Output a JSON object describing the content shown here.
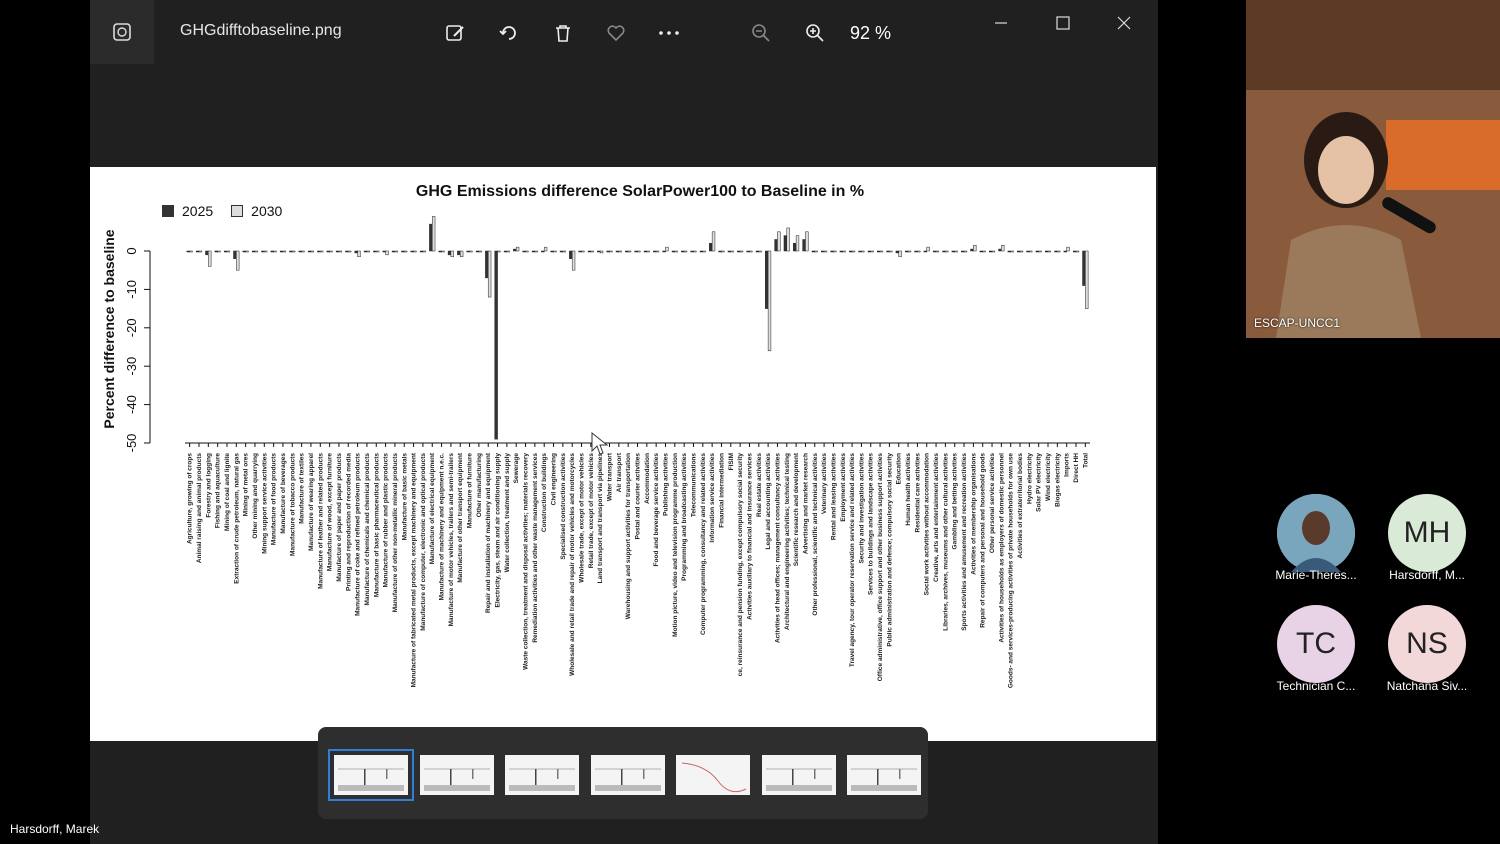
{
  "viewer": {
    "filename": "GHGdifftobaseline.png",
    "zoom": "92 %",
    "toolbar_icons": [
      "edit-image-icon",
      "rotate-icon",
      "delete-icon",
      "favorite-icon",
      "more-icon",
      "zoom-out-icon",
      "zoom-in-icon"
    ],
    "window_icons": [
      "minimize-icon",
      "maximize-icon",
      "close-icon"
    ]
  },
  "chart_data": {
    "type": "bar",
    "title": "GHG Emissions difference SolarPower100 to Baseline in %",
    "ylabel": "Percent difference to baseline",
    "ylim": [
      -50,
      0
    ],
    "yticks": [
      "0",
      "-10",
      "-20",
      "-30",
      "-40",
      "-50"
    ],
    "series": [
      {
        "name": "2025",
        "color": "#333333"
      },
      {
        "name": "2030",
        "color": "#dddddd"
      }
    ],
    "categories": [
      "Agriculture, growing of crops",
      "Animal raising and animal products",
      "Forestry and logging",
      "Fishing and aquaculture",
      "Mining of coal and lignite",
      "Extraction of crude petroleum, natural gas",
      "Mining of metal ores",
      "Other mining and quarrying",
      "Mining support service activities",
      "Manufacture of food products",
      "Manufacture of beverages",
      "Manufacture of tobacco products",
      "Manufacture of textiles",
      "Manufacture of wearing apparel",
      "Manufacture of leather and related products",
      "Manufacture of wood, except furniture",
      "Manufacture of paper and paper products",
      "Printing and reproduction of recorded media",
      "Manufacture of coke and refined petroleum products",
      "Manufacture of chemicals and chemical products",
      "Manufacture of basic pharmaceutical products",
      "Manufacture of rubber and plastic products",
      "Manufacture of other non-metallic mineral products",
      "Manufacture of basic metals",
      "Manufacture of fabricated metal products, except machinery and equipment",
      "Manufacture of computer, electronic and optical products",
      "Manufacture of electrical equipment",
      "Manufacture of machinery and equipment n.e.c.",
      "Manufacture of motor vehicles, trailers and semi-trailers",
      "Manufacture of other transport equipment",
      "Manufacture of furniture",
      "Other manufacturing",
      "Repair and installation of machinery and equipment",
      "Electricity, gas, steam and air conditioning supply",
      "Water collection, treatment and supply",
      "Sewerage",
      "Waste collection, treatment and disposal activities; materials recovery",
      "Remediation activities and other waste management services",
      "Construction of buildings",
      "Civil engineering",
      "Specialised construction activities",
      "Wholesale and retail trade and repair of motor vehicles and motorcycles",
      "Wholesale trade, except of motor vehicles",
      "Retail trade, except of motor vehicles",
      "Land transport and transport via pipelines",
      "Water transport",
      "Air transport",
      "Warehousing and support activities for transportation",
      "Postal and courier activities",
      "Accommodation",
      "Food and beverage service activities",
      "Publishing activities",
      "Motion picture, video and television programme production",
      "Programming and broadcasting activities",
      "Telecommunications",
      "Computer programming, consultancy and related activities",
      "Information service activities",
      "Financial intermediation",
      "FISIM",
      "ce, reinsurance and pension funding, except compulsory social security",
      "Activities auxiliary to financial and insurance services",
      "Real estate activities",
      "Legal and accounting activities",
      "Activities of head offices; management consultancy activities",
      "Architectural and engineering activities; technical testing",
      "Scientific research and development",
      "Advertising and market research",
      "Other professional, scientific and technical activities",
      "Veterinary activities",
      "Rental and leasing activities",
      "Employment activities",
      "Travel agency, tour operator reservation service and related activities",
      "Security and investigation activities",
      "Services to buildings and landscape activities",
      "Office administrative, office support and other business support activities",
      "Public administration and defence; compulsory social security",
      "Education",
      "Human health activities",
      "Residential care activities",
      "Social work activities without accommodation",
      "Creative, arts and entertainment activities",
      "Libraries, archives, museums and other cultural activities",
      "Gambling and betting activities",
      "Sports activities and amusement and recreation activities",
      "Activities of membership organisations",
      "Repair of computers and personal and household goods",
      "Other personal service activities",
      "Activities of households as employers of domestic personnel",
      "Goods- and services-producing activities of private households for own use",
      "Activities of extraterritorial bodies",
      "Hydro electricity",
      "Solar PV electricity",
      "Wind electricity",
      "Biogas electricity",
      "Imports",
      "Direct HH",
      "Total"
    ],
    "values_2025": [
      0,
      0,
      -1,
      0,
      0,
      -2,
      0,
      0,
      0,
      0,
      0,
      0,
      0,
      0,
      0,
      0,
      0,
      0,
      -0.5,
      0,
      0,
      0,
      0,
      0,
      0,
      0,
      7,
      0,
      -1,
      -1,
      0,
      0,
      -7,
      -49,
      0,
      0.5,
      0,
      0,
      0,
      0,
      0,
      -2,
      0,
      0,
      0,
      0,
      0,
      0,
      0,
      0,
      0,
      0,
      0,
      0,
      0,
      0,
      2,
      0,
      0,
      0,
      0,
      0,
      -15,
      3,
      4,
      2,
      3,
      0,
      0,
      0,
      0,
      0,
      0,
      0,
      0,
      0,
      -0.5,
      0,
      0,
      0,
      0,
      0,
      0,
      0,
      0.5,
      0,
      0,
      0.5,
      0,
      0,
      0,
      0,
      0,
      0,
      0,
      0,
      -9
    ],
    "values_2030": [
      0,
      0,
      -4,
      0,
      0,
      -5,
      0,
      0,
      0,
      0,
      0,
      0,
      0,
      0,
      0,
      0,
      0,
      0,
      -1.5,
      0,
      0,
      -1,
      0,
      0,
      0,
      0,
      9,
      0,
      -1.5,
      -1.5,
      0,
      0,
      -12,
      0,
      0,
      1,
      0,
      0,
      1,
      0,
      0,
      -5,
      0,
      0,
      -0.5,
      0,
      0,
      0,
      0,
      0,
      0,
      1,
      0,
      0,
      0,
      0,
      5,
      0,
      0,
      0,
      0,
      0,
      -26,
      5,
      6,
      4,
      5,
      0,
      0,
      0,
      0,
      0,
      0,
      0,
      0,
      0,
      -1.5,
      0,
      0,
      1,
      0,
      0,
      0,
      0,
      1.5,
      0,
      0,
      1.5,
      0,
      0,
      0,
      0,
      0,
      0,
      1,
      0,
      -15
    ],
    "legend_position": "top-left",
    "grid": false
  },
  "thumbnails": {
    "count": 7,
    "selected_index": 0
  },
  "presenter": "Harsdorff, Marek",
  "video": {
    "label": "ESCAP-UNCC1"
  },
  "participants": [
    {
      "initials": "",
      "name": "Marie-Theres...",
      "color": "#8fb7c9"
    },
    {
      "initials": "MH",
      "name": "Harsdorff, M...",
      "color": "#d9ead7"
    },
    {
      "initials": "TC",
      "name": "Technician C...",
      "color": "#e8d3e6"
    },
    {
      "initials": "NS",
      "name": "Natchana Siv...",
      "color": "#f3d8da"
    }
  ]
}
